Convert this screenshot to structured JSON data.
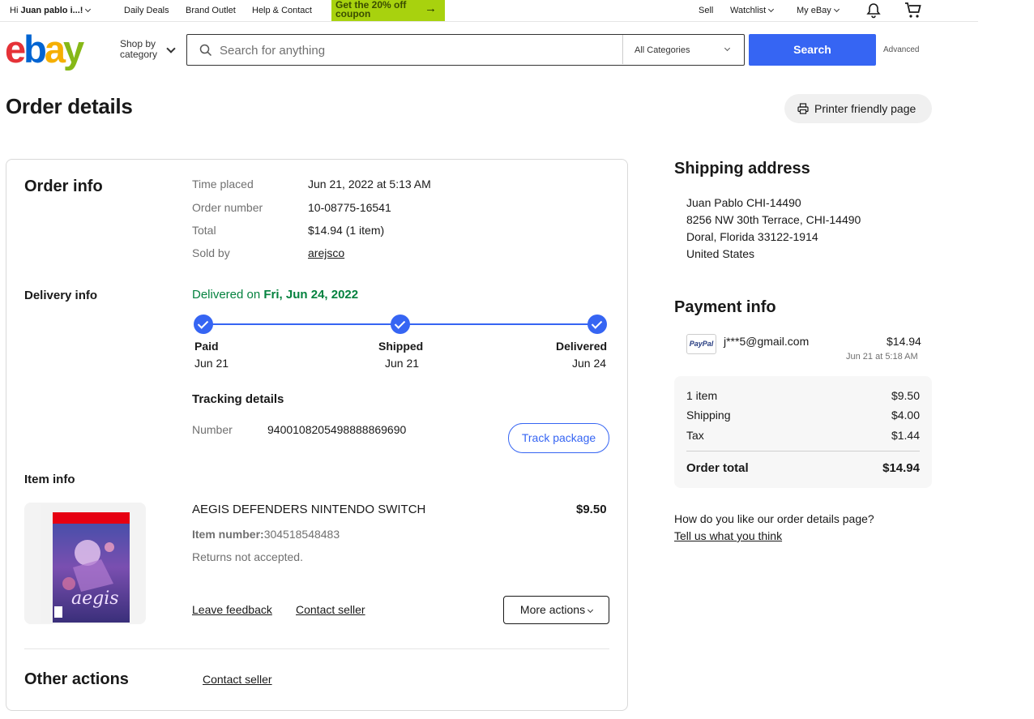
{
  "topnav": {
    "greeting_prefix": "Hi ",
    "user_name": "Juan pablo i...!",
    "daily_deals": "Daily Deals",
    "brand_outlet": "Brand Outlet",
    "help_contact": "Help & Contact",
    "promo_line1": "Get the 20% off",
    "promo_line2": "coupon",
    "sell": "Sell",
    "watchlist": "Watchlist",
    "my_ebay": "My eBay"
  },
  "header": {
    "logo": {
      "e": "e",
      "b": "b",
      "a": "a",
      "y": "y"
    },
    "shop_by_line1": "Shop by",
    "shop_by_line2": "category",
    "search_placeholder": "Search for anything",
    "category_select": "All Categories",
    "search_button": "Search",
    "advanced": "Advanced"
  },
  "page": {
    "title": "Order details",
    "print_button": "Printer friendly page"
  },
  "order_info": {
    "heading": "Order info",
    "rows": [
      {
        "label": "Time placed",
        "value": "Jun 21, 2022 at 5:13 AM"
      },
      {
        "label": "Order number",
        "value": "10-08775-16541"
      },
      {
        "label": "Total",
        "value": "$14.94 (1 item)"
      },
      {
        "label": "Sold by",
        "value": "arejsco"
      }
    ]
  },
  "delivery_info": {
    "heading": "Delivery info",
    "status_prefix": "Delivered on ",
    "status_date": "Fri, Jun 24, 2022",
    "steps": [
      {
        "label": "Paid",
        "date": "Jun 21"
      },
      {
        "label": "Shipped",
        "date": "Jun 21"
      },
      {
        "label": "Delivered",
        "date": "Jun 24"
      }
    ],
    "tracking_heading": "Tracking details",
    "tracking_label": "Number",
    "tracking_number": "9400108205498888869690",
    "track_button": "Track package"
  },
  "item_info": {
    "heading": "Item info",
    "title": "AEGIS DEFENDERS NINTENDO SWITCH",
    "price": "$9.50",
    "item_number_label": "Item number:",
    "item_number": "304518548483",
    "returns": "Returns not accepted.",
    "leave_feedback": "Leave feedback",
    "contact_seller": "Contact seller",
    "more_actions": "More actions",
    "cover_logo_text": "aegis"
  },
  "other_actions": {
    "heading": "Other actions",
    "contact_seller": "Contact seller"
  },
  "shipping_address": {
    "heading": "Shipping address",
    "lines": [
      "Juan Pablo CHI-14490",
      "8256 NW 30th Terrace, CHI-14490",
      "Doral, Florida 33122-1914",
      "United States"
    ]
  },
  "payment_info": {
    "heading": "Payment info",
    "method_logo": "PayPal",
    "account": "j***5@gmail.com",
    "amount": "$14.94",
    "date": "Jun 21 at 5:18 AM",
    "summary": [
      {
        "label": "1 item",
        "value": "$9.50"
      },
      {
        "label": "Shipping",
        "value": "$4.00"
      },
      {
        "label": "Tax",
        "value": "$1.44"
      }
    ],
    "total_label": "Order total",
    "total_value": "$14.94"
  },
  "feedback": {
    "question": "How do you like our order details page?",
    "link": "Tell us what you think"
  },
  "colors": {
    "accent_blue": "#3665f3",
    "delivered_green": "#05823f",
    "promo_green": "#a8d20e"
  }
}
